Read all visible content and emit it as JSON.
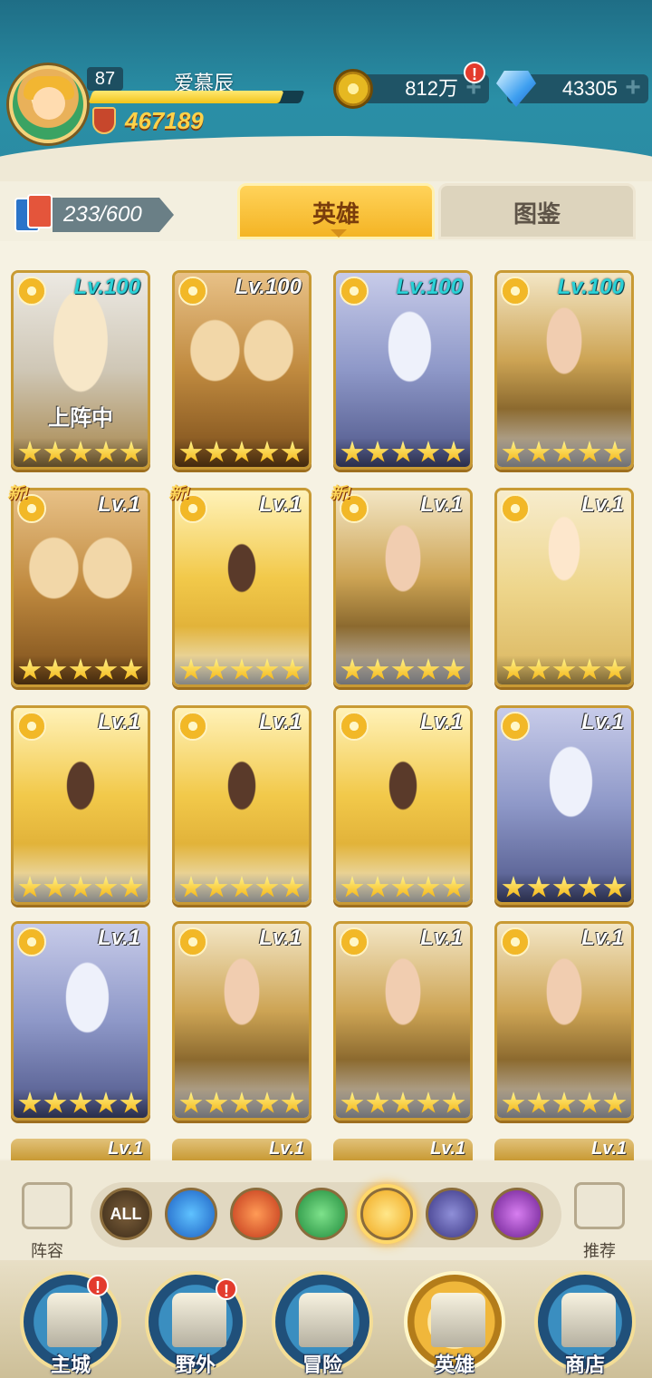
{
  "player": {
    "level": "87",
    "name": "爱慕辰",
    "xp_fraction": 0.9,
    "power": "467189"
  },
  "currency": {
    "gold": "812万",
    "gems": "43305",
    "plus": "+",
    "alert": "!"
  },
  "roster": {
    "count": "233/600"
  },
  "tabs": {
    "heroes": "英雄",
    "atlas": "图鉴"
  },
  "heroes": [
    {
      "level": "Lv.100",
      "stars": 5,
      "badge": "上阵中",
      "new": "",
      "art": "hood",
      "max": true
    },
    {
      "level": "Lv.100",
      "stars": 5,
      "badge": "",
      "new": "",
      "art": "twins",
      "max": false
    },
    {
      "level": "Lv.100",
      "stars": 5,
      "badge": "",
      "new": "",
      "art": "elf",
      "max": true
    },
    {
      "level": "Lv.100",
      "stars": 5,
      "badge": "",
      "new": "",
      "art": "king",
      "max": true
    },
    {
      "level": "Lv.1",
      "stars": 5,
      "badge": "",
      "new": "新!",
      "art": "twins",
      "max": false
    },
    {
      "level": "Lv.1",
      "stars": 5,
      "badge": "",
      "new": "新!",
      "art": "goddess",
      "max": false
    },
    {
      "level": "Lv.1",
      "stars": 5,
      "badge": "",
      "new": "新!",
      "art": "king",
      "max": false
    },
    {
      "level": "Lv.1",
      "stars": 5,
      "badge": "",
      "new": "",
      "art": "sage",
      "max": false
    },
    {
      "level": "Lv.1",
      "stars": 5,
      "badge": "",
      "new": "",
      "art": "goddess",
      "max": false
    },
    {
      "level": "Lv.1",
      "stars": 5,
      "badge": "",
      "new": "",
      "art": "goddess",
      "max": false
    },
    {
      "level": "Lv.1",
      "stars": 5,
      "badge": "",
      "new": "",
      "art": "goddess",
      "max": false
    },
    {
      "level": "Lv.1",
      "stars": 5,
      "badge": "",
      "new": "",
      "art": "elf",
      "max": false
    },
    {
      "level": "Lv.1",
      "stars": 5,
      "badge": "",
      "new": "",
      "art": "elf",
      "max": false
    },
    {
      "level": "Lv.1",
      "stars": 5,
      "badge": "",
      "new": "",
      "art": "king",
      "max": false
    },
    {
      "level": "Lv.1",
      "stars": 5,
      "badge": "",
      "new": "",
      "art": "king",
      "max": false
    },
    {
      "level": "Lv.1",
      "stars": 5,
      "badge": "",
      "new": "",
      "art": "king",
      "max": false
    }
  ],
  "partial_row_levels": [
    "Lv.1",
    "Lv.1",
    "Lv.1",
    "Lv.1"
  ],
  "filters": {
    "all": "ALL",
    "items": [
      "water",
      "fire",
      "wind",
      "light",
      "dark",
      "void"
    ],
    "selected": "light",
    "lineup_label": "阵容",
    "recommend_label": "推荐"
  },
  "nav": [
    {
      "label": "主城",
      "alert": "!"
    },
    {
      "label": "野外",
      "alert": "!"
    },
    {
      "label": "冒险",
      "alert": ""
    },
    {
      "label": "英雄",
      "alert": ""
    },
    {
      "label": "商店",
      "alert": ""
    }
  ],
  "colors": {
    "header": "#2a8fa6",
    "gold_tab": "#f4b424",
    "max_level": "#2ad1d6"
  }
}
